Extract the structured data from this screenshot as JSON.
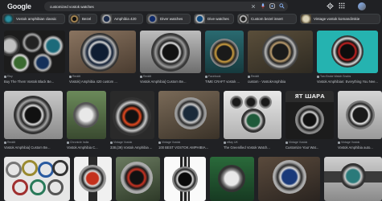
{
  "header": {
    "logo": "Google",
    "query": "customized vostok watches"
  },
  "chips": [
    {
      "label": "Vostok amphibian classic"
    },
    {
      "label": "Bezel"
    },
    {
      "label": "Amphibia 420"
    },
    {
      "label": "Diver watches"
    },
    {
      "label": "Dive watches"
    },
    {
      "label": "Custom bezel insert"
    },
    {
      "label": "Vintage vostok komandirskie"
    }
  ],
  "results": [
    {
      "source": "Etsy",
      "title": "Buy The Them Vostok Black Be..."
    },
    {
      "source": "Reddit",
      "title": "Vostok) Amphibia 420 custom ..."
    },
    {
      "source": "Reddit",
      "title": "Vostok Amphibia] Custom Be..."
    },
    {
      "source": "Facebook",
      "title": "TIME CRAFT vostok ..."
    },
    {
      "source": "Reddit",
      "title": "custom - VostokAmphibia"
    },
    {
      "source": "Two Broke Watch Snobs",
      "title": "Vostok Amphibian: Everything You Nee..."
    },
    {
      "source": "Reddit",
      "title": "Vostok Amphibia] Custom Be..."
    },
    {
      "source": "Chronicle India",
      "title": "Vostok Amphibia C..."
    },
    {
      "source": "Vintage Vostok",
      "title": "338.(39) Vostok Amphibia ..."
    },
    {
      "source": "Vintage Vostok",
      "title": "100 BEST VOSTOK AMPHIBIA..."
    },
    {
      "source": "eBay UK",
      "title": "The Greenified Vostok Watch..."
    },
    {
      "source": "Vintage Vostok",
      "title": "Customize Your Wat..."
    },
    {
      "source": "Vintage Vostok",
      "title": "Vostok Amphibia auto..."
    },
    {
      "source": "",
      "title": ""
    },
    {
      "source": "",
      "title": ""
    },
    {
      "source": "",
      "title": ""
    },
    {
      "source": "",
      "title": ""
    },
    {
      "source": "",
      "title": ""
    },
    {
      "source": "",
      "title": ""
    },
    {
      "source": "",
      "title": ""
    },
    {
      "source": "",
      "title": ""
    }
  ],
  "colors": {
    "background": "#202124",
    "chip_bg": "#303134",
    "text_primary": "#e8eaed",
    "text_secondary": "#9aa0a6"
  },
  "icons": [
    "close-icon",
    "mic-icon",
    "lens-icon",
    "search-icon",
    "settings-gear-icon",
    "apps-grid-icon"
  ]
}
